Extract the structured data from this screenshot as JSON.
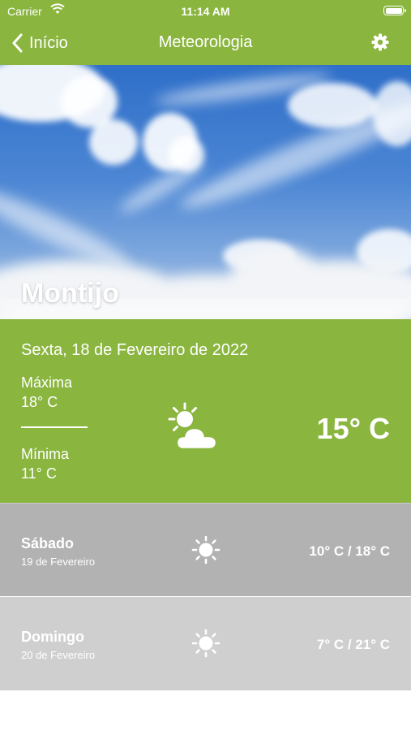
{
  "status_bar": {
    "carrier": "Carrier",
    "time": "11:14 AM"
  },
  "nav": {
    "back_label": "Início",
    "title": "Meteorologia"
  },
  "hero": {
    "city": "Montijo"
  },
  "today": {
    "date": "Sexta, 18 de Fevereiro de 2022",
    "max_label": "Máxima",
    "max_value": "18° C",
    "min_label": "Mínima",
    "min_value": "11° C",
    "current_temp": "15° C",
    "icon": "partly-cloudy-icon"
  },
  "forecast": [
    {
      "day": "Sábado",
      "date": "19 de Fevereiro",
      "temps": "10° C / 18° C",
      "icon": "sun-icon"
    },
    {
      "day": "Domingo",
      "date": "20 de Fevereiro",
      "temps": "7° C / 21° C",
      "icon": "sun-icon"
    }
  ],
  "colors": {
    "accent": "#8ab53f",
    "row1": "#b2b2b2",
    "row2": "#cfcfcf"
  }
}
